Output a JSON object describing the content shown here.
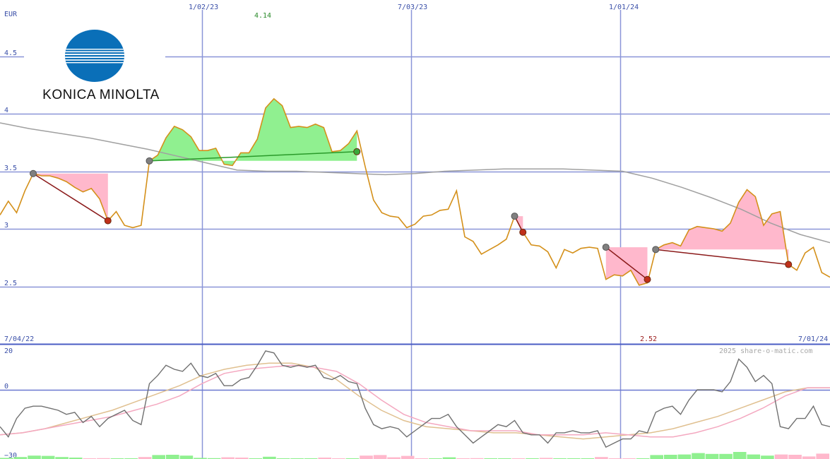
{
  "brand": {
    "logo_text": "KONICA MINOLTA",
    "watermark": "2025 share-o-matic.com",
    "logo_color": "#0a6fb8"
  },
  "labels": {
    "currency": "EUR",
    "y_ticks": [
      "4.5",
      "4",
      "3.5",
      "3",
      "2.5"
    ],
    "x_top": [
      "1/02/23",
      "7/03/23",
      "1/01/24"
    ],
    "x_range_start": "7/04/22",
    "x_range_end": "7/01/24",
    "high_value": "4.14",
    "low_value": "2.52",
    "osc_ticks": [
      "20",
      "0",
      "−30"
    ]
  },
  "colors": {
    "price": "#d4901a",
    "moving_average": "#a0a0a0",
    "grid": "#8a95d8",
    "gain_fill": "#90f090",
    "loss_fill": "#ffb8cc",
    "gain_line": "#2a9a2a",
    "loss_line": "#8b1a1a",
    "osc_main": "#707070",
    "osc_pink": "#f4a8c0",
    "osc_tan": "#e0c090"
  },
  "chart_data": [
    {
      "type": "line",
      "x_range": [
        "7/04/22",
        "7/01/24"
      ],
      "ylim": [
        2.3,
        4.9
      ],
      "grid": true,
      "series": [
        {
          "role": "price",
          "values": [
            3.12,
            3.24,
            3.14,
            3.33,
            3.48,
            3.46,
            3.46,
            3.44,
            3.41,
            3.36,
            3.32,
            3.35,
            3.26,
            3.07,
            3.15,
            3.03,
            3.01,
            3.03,
            3.59,
            3.64,
            3.79,
            3.89,
            3.86,
            3.8,
            3.68,
            3.68,
            3.7,
            3.56,
            3.55,
            3.66,
            3.66,
            3.78,
            4.05,
            4.13,
            4.07,
            3.88,
            3.89,
            3.88,
            3.91,
            3.88,
            3.67,
            3.68,
            3.74,
            3.85,
            3.54,
            3.25,
            3.14,
            3.11,
            3.1,
            3.01,
            3.04,
            3.11,
            3.12,
            3.16,
            3.17,
            3.33,
            2.93,
            2.89,
            2.78,
            2.82,
            2.86,
            2.91,
            3.11,
            2.97,
            2.86,
            2.85,
            2.8,
            2.66,
            2.82,
            2.79,
            2.83,
            2.84,
            2.83,
            2.56,
            2.6,
            2.59,
            2.64,
            2.51,
            2.53,
            2.82,
            2.86,
            2.88,
            2.85,
            2.99,
            3.02,
            3.01,
            3.0,
            2.98,
            3.05,
            3.23,
            3.34,
            3.28,
            3.03,
            3.13,
            3.15,
            2.69,
            2.64,
            2.79,
            2.84,
            2.62,
            2.58
          ]
        },
        {
          "role": "moving_average",
          "values": [
            3.92,
            3.87,
            3.83,
            3.79,
            3.74,
            3.69,
            3.63,
            3.57,
            3.51,
            3.5,
            3.5,
            3.49,
            3.48,
            3.47,
            3.48,
            3.5,
            3.51,
            3.52,
            3.52,
            3.52,
            3.51,
            3.5,
            3.44,
            3.36,
            3.27,
            3.17,
            3.05,
            2.95,
            2.88
          ]
        }
      ],
      "trades": [
        {
          "kind": "loss",
          "from": "3.48",
          "to": "3.07"
        },
        {
          "kind": "gain",
          "from": "3.59",
          "to": "3.67"
        },
        {
          "kind": "loss",
          "from": "3.11",
          "to": "2.97"
        },
        {
          "kind": "loss",
          "from": "2.84",
          "to": "2.56"
        },
        {
          "kind": "loss",
          "from": "2.82",
          "to": "2.69"
        }
      ],
      "high": 4.14,
      "low": 2.52
    },
    {
      "type": "line",
      "ylim": [
        -30,
        25
      ],
      "grid": true,
      "series": [
        {
          "role": "oscillator",
          "values": [
            -18,
            -23,
            -14,
            -9,
            -8,
            -8,
            -9,
            -10,
            -12,
            -11,
            -16,
            -13,
            -18,
            -14,
            -12,
            -10,
            -15,
            -17,
            3,
            7,
            12,
            10,
            9,
            13,
            7,
            6,
            8,
            2,
            2,
            5,
            6,
            12,
            19,
            18,
            12,
            11,
            12,
            11,
            12,
            6,
            5,
            7,
            4,
            3,
            -9,
            -17,
            -19,
            -18,
            -19,
            -23,
            -20,
            -17,
            -14,
            -14,
            -12,
            -18,
            -22,
            -26,
            -23,
            -20,
            -17,
            -18,
            -15,
            -21,
            -22,
            -22,
            -26,
            -21,
            -21,
            -20,
            -21,
            -21,
            -20,
            -28,
            -26,
            -24,
            -24,
            -20,
            -21,
            -11,
            -9,
            -8,
            -12,
            -5,
            0,
            0,
            0,
            -1,
            4,
            15,
            11,
            4,
            7,
            3,
            -18,
            -19,
            -14,
            -14,
            -8,
            -17,
            -18
          ]
        },
        {
          "role": "signal",
          "values": [
            -22,
            -21,
            -19,
            -17,
            -15,
            -13,
            -10,
            -7,
            -3,
            3,
            8,
            10,
            11,
            12,
            11,
            9,
            3,
            -5,
            -12,
            -16,
            -18,
            -20,
            -20,
            -20,
            -22,
            -22,
            -22,
            -21,
            -22,
            -23,
            -23,
            -21,
            -18,
            -14,
            -9,
            -3,
            1,
            1
          ]
        },
        {
          "role": "signal_slow",
          "values": [
            -22,
            -21,
            -19,
            -16,
            -13,
            -10,
            -6,
            -2,
            2,
            7,
            10,
            12,
            13,
            13,
            11,
            5,
            -3,
            -10,
            -15,
            -18,
            -19,
            -20,
            -21,
            -21,
            -22,
            -23,
            -24,
            -23,
            -22,
            -21,
            -19,
            -16,
            -13,
            -9,
            -5,
            -1,
            1,
            1
          ]
        }
      ]
    }
  ]
}
